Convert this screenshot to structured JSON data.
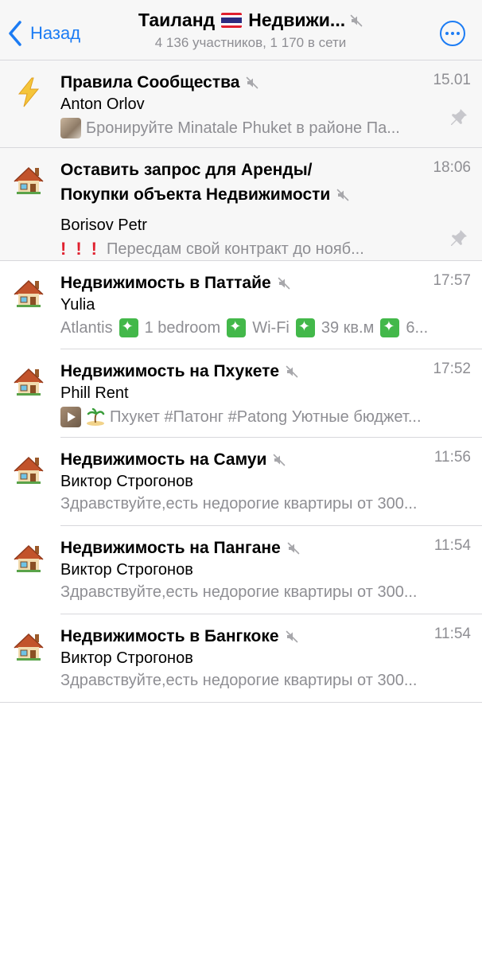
{
  "header": {
    "back_label": "Назад",
    "title": "Таиланд",
    "title_suffix": "Недвижи...",
    "subtitle": "4 136 участников, 1 170 в сети"
  },
  "chats": [
    {
      "title": "Правила Сообщества",
      "time": "15.01",
      "sender": "Anton Orlov",
      "preview": "Бронируйте Minatale Phuket в районе Па...",
      "icon": "lightning-icon",
      "pinned": true
    },
    {
      "title_line1": "Оставить запрос для Аренды/",
      "title_line2": "Покупки объекта Недвижимости",
      "time": "18:06",
      "sender": "Borisov Petr",
      "preview": "Пересдам свой контракт до нояб...",
      "icon": "house-icon",
      "pinned": true
    },
    {
      "title": "Недвижимость в Паттайе",
      "time": "17:57",
      "sender": "Yulia",
      "preview_parts": [
        "Atlantis",
        "1 bedroom",
        "Wi-Fi",
        "39 кв.м",
        "6..."
      ],
      "icon": "house-icon"
    },
    {
      "title": "Недвижимость на Пхукете",
      "time": "17:52",
      "sender": "Phill Rent",
      "preview": "Пхукет #Патонг #Patong Уютные бюджет...",
      "icon": "house-icon"
    },
    {
      "title": "Недвижимость на Самуи",
      "time": "11:56",
      "sender": "Виктор Строгонов",
      "preview": "Здравствуйте,есть недорогие квартиры от 300...",
      "icon": "house-icon"
    },
    {
      "title": "Недвижимость на Пангане",
      "time": "11:54",
      "sender": "Виктор Строгонов",
      "preview": "Здравствуйте,есть недорогие квартиры от 300...",
      "icon": "house-icon"
    },
    {
      "title": "Недвижимость в Бангкоке",
      "time": "11:54",
      "sender": "Виктор Строгонов",
      "preview": "Здравствуйте,есть недорогие квартиры от 300...",
      "icon": "house-icon"
    }
  ],
  "colors": {
    "accent": "#1c7cf4",
    "secondary_text": "#8e8e93",
    "pinned_background": "#f7f7f7",
    "separator": "#d8d8dc"
  }
}
